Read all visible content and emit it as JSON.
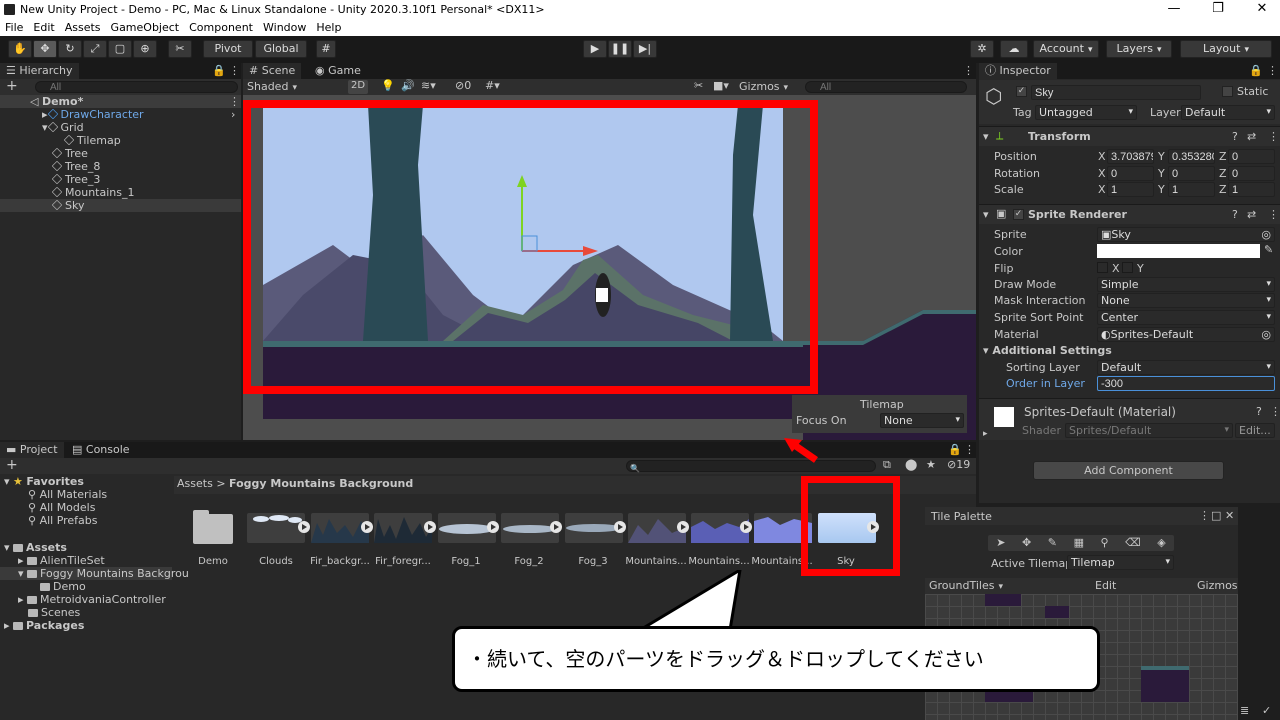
{
  "window": {
    "title": "New Unity Project - Demo - PC, Mac & Linux Standalone - Unity 2020.3.10f1 Personal* <DX11>",
    "minimize": "—",
    "maximize": "❐",
    "close": "✕"
  },
  "menu": [
    "File",
    "Edit",
    "Assets",
    "GameObject",
    "Component",
    "Window",
    "Help"
  ],
  "toolbar": {
    "pivot": "Pivot",
    "global": "Global",
    "account": "Account",
    "layers": "Layers",
    "layout": "Layout"
  },
  "hierarchy": {
    "tab": "Hierarchy",
    "add": "+",
    "search_placeholder": "All",
    "scene": "Demo*",
    "items": [
      "DrawCharacter",
      "Grid",
      "Tilemap",
      "Tree",
      "Tree_8",
      "Tree_3",
      "Mountains_1",
      "Sky"
    ]
  },
  "scene": {
    "tabs": [
      "Scene",
      "Game"
    ],
    "shading": "Shaded",
    "mode2d": "2D",
    "hidden_count": "0",
    "gizmos": "Gizmos",
    "search_placeholder": "All",
    "overlay_title": "Tilemap",
    "focus_label": "Focus On",
    "focus_value": "None"
  },
  "inspector": {
    "tab": "Inspector",
    "object_name": "Sky",
    "static": "Static",
    "tag_label": "Tag",
    "tag_value": "Untagged",
    "layer_label": "Layer",
    "layer_value": "Default",
    "transform": {
      "title": "Transform",
      "position": {
        "label": "Position",
        "x": "3.703879",
        "y": "0.353280",
        "z": "0"
      },
      "rotation": {
        "label": "Rotation",
        "x": "0",
        "y": "0",
        "z": "0"
      },
      "scale": {
        "label": "Scale",
        "x": "1",
        "y": "1",
        "z": "1"
      }
    },
    "sprite_renderer": {
      "title": "Sprite Renderer",
      "sprite_label": "Sprite",
      "sprite_value": "Sky",
      "color_label": "Color",
      "flip_label": "Flip",
      "flip_x": "X",
      "flip_y": "Y",
      "draw_mode_label": "Draw Mode",
      "draw_mode_value": "Simple",
      "mask_label": "Mask Interaction",
      "mask_value": "None",
      "sort_point_label": "Sprite Sort Point",
      "sort_point_value": "Center",
      "material_label": "Material",
      "material_value": "Sprites-Default",
      "additional": "Additional Settings",
      "sorting_layer_label": "Sorting Layer",
      "sorting_layer_value": "Default",
      "order_label": "Order in Layer",
      "order_value": "-300"
    },
    "material": {
      "name": "Sprites-Default (Material)",
      "shader_label": "Shader",
      "shader_value": "Sprites/Default",
      "edit": "Edit..."
    },
    "add_component": "Add Component"
  },
  "project": {
    "tabs": [
      "Project",
      "Console"
    ],
    "add": "+",
    "hidden_count": "19",
    "breadcrumb_root": "Assets",
    "breadcrumb_sep": ">",
    "breadcrumb_current": "Foggy Mountains Background",
    "favorites": {
      "title": "Favorites",
      "items": [
        "All Materials",
        "All Models",
        "All Prefabs"
      ]
    },
    "assets": {
      "title": "Assets",
      "items": [
        "AlienTileSet",
        "Foggy Mountains Backgrou",
        "Demo",
        "MetroidvaniaController",
        "Scenes"
      ]
    },
    "packages": "Packages",
    "grid": [
      "Demo",
      "Clouds",
      "Fir_backgr...",
      "Fir_foregr...",
      "Fog_1",
      "Fog_2",
      "Fog_3",
      "Mountains...",
      "Mountains...",
      "Mountains...",
      "Sky"
    ]
  },
  "tile_palette": {
    "title": "Tile Palette",
    "active_label": "Active Tilemap",
    "active_value": "Tilemap",
    "palette": "GroundTiles",
    "edit": "Edit",
    "gizmos": "Gizmos"
  },
  "callout": {
    "text": "・続いて、空のパーツをドラッグ＆ドロップしてください"
  },
  "colors": {
    "highlight": "#ff0000",
    "accent_blue": "#4a90d9",
    "sky_top": "#b4c9f2",
    "sky_bottom": "#a8c8f0"
  }
}
